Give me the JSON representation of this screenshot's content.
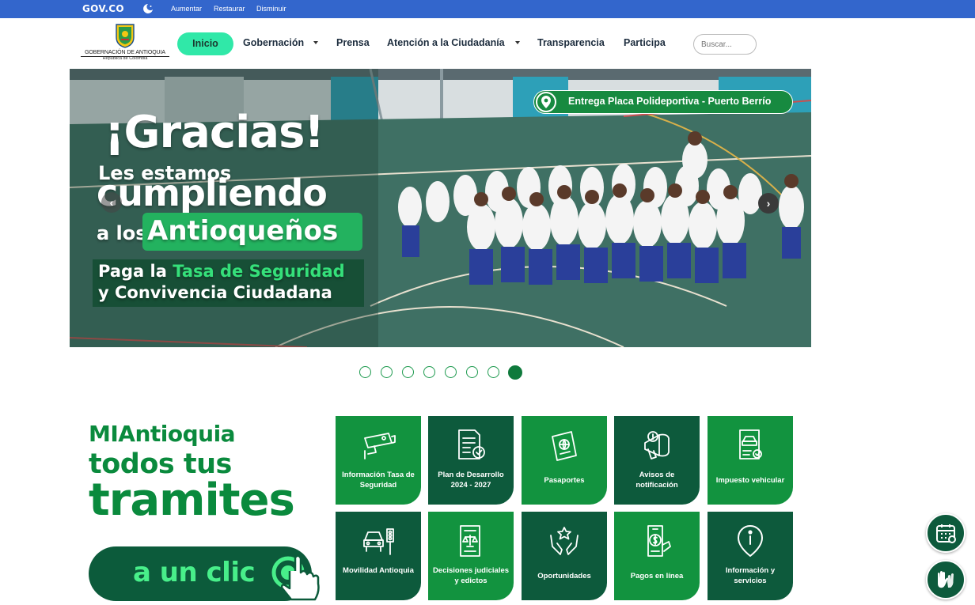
{
  "govbar": {
    "logo": "GOV.CO",
    "links": [
      "Aumentar",
      "Restaurar",
      "Disminuir"
    ]
  },
  "brand": {
    "line1": "GOBERNACIÓN DE ANTIOQUIA",
    "line2": "República de Colombia"
  },
  "nav": {
    "home": "Inicio",
    "items": [
      "Gobernación",
      "Prensa",
      "Atención a la Ciudadanía",
      "Transparencia",
      "Participa"
    ],
    "search_placeholder": "Buscar..."
  },
  "carousel": {
    "location_label": "Entrega Placa Polideportiva",
    "location_place": "Puerto Berrío",
    "headline": "¡Gracias!",
    "line_les": "Les estamos",
    "line_cumpliendo": "cumpliendo",
    "line_alos": "a los",
    "line_antioquenos": "Antioqueños",
    "paga_1": "Paga la",
    "paga_accent": "Tasa",
    "paga_rest": "de Seguridad",
    "paga_2": "y Convivencia Ciudadana",
    "prev_glyph": "‹",
    "next_glyph": "›",
    "slides": 8,
    "active_slide": 8
  },
  "mia": {
    "brand_bold": "MIA",
    "brand_rest": "ntioquia",
    "line2": "todos tus",
    "line3": "tramites",
    "cta": "a un clic"
  },
  "tiles": [
    {
      "label": "Información Tasa de Seguridad",
      "icon": "cctv-camera-icon",
      "color": "green"
    },
    {
      "label": "Plan de Desarrollo 2024 - 2027",
      "icon": "document-check-icon",
      "color": "dark"
    },
    {
      "label": "Pasaportes",
      "icon": "passport-icon",
      "color": "green"
    },
    {
      "label": "Avisos de notificación",
      "icon": "megaphone-icon",
      "color": "dark"
    },
    {
      "label": "Impuesto vehicular",
      "icon": "vehicle-document-icon",
      "color": "green"
    },
    {
      "label": "Movilidad Antioquia",
      "icon": "car-traffic-light-icon",
      "color": "dark"
    },
    {
      "label": "Decisiones judiciales y edictos",
      "icon": "judicial-document-icon",
      "color": "green"
    },
    {
      "label": "Oportunidades",
      "icon": "hands-star-icon",
      "color": "dark"
    },
    {
      "label": "Pagos en línea",
      "icon": "phone-payment-icon",
      "color": "green"
    },
    {
      "label": "Información y servicios",
      "icon": "info-pin-icon",
      "color": "dark"
    }
  ],
  "floating": [
    "calendar-icon",
    "sign-language-icon"
  ],
  "colors": {
    "govbar": "#3366cc",
    "accent": "#30e8a8",
    "green": "#12933f",
    "dark_green": "#0d5a3c"
  }
}
